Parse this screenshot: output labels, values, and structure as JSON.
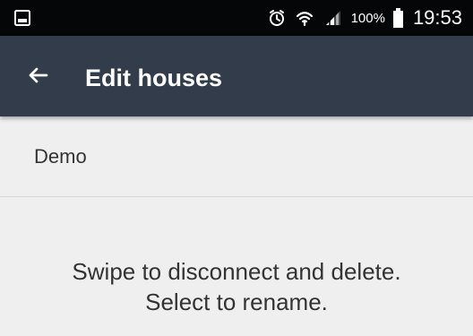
{
  "status_bar": {
    "battery_percent": "100%",
    "time": "19:53",
    "left_icon": "screenshot-icon",
    "alarm_icon": "alarm-clock-icon",
    "wifi_icon": "wifi-icon",
    "signal_icon": "cellular-signal-icon",
    "battery_icon": "battery-icon"
  },
  "app_bar": {
    "title": "Edit houses",
    "back_icon": "back-arrow-icon",
    "background_color": "#323c4a"
  },
  "houses": [
    {
      "name": "Demo"
    }
  ],
  "instructions": {
    "line1": "Swipe to disconnect and delete.",
    "line2": "Select to rename."
  },
  "colors": {
    "status_bar": "#050608",
    "page_background": "#efefef",
    "text": "#333333",
    "divider": "#d8d8d8"
  }
}
